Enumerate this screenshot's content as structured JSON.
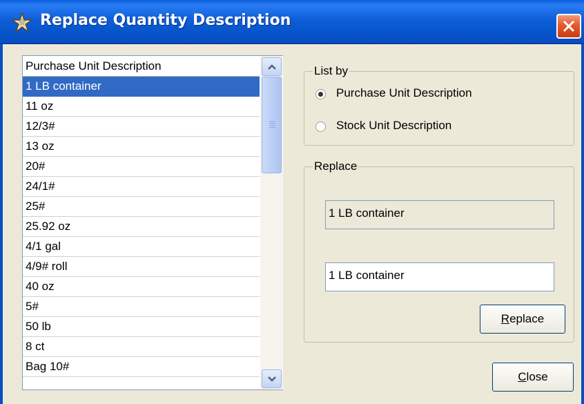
{
  "window": {
    "title": "Replace Quantity Description",
    "icon": "sparkle-app-icon",
    "close_icon": "close-x-icon"
  },
  "list": {
    "header": "Purchase Unit Description",
    "items": [
      "1 LB container",
      "11 oz",
      "12/3#",
      "13 oz",
      "20#",
      "24/1#",
      "25#",
      "25.92 oz",
      "4/1 gal",
      "4/9# roll",
      "40 oz",
      "5#",
      "50 lb",
      "8 ct",
      "Bag 10#"
    ],
    "selected_item": "1 LB container"
  },
  "list_by": {
    "label": "List by",
    "options": [
      "Purchase Unit Description",
      "Stock Unit Description"
    ],
    "selected": "Purchase Unit Description"
  },
  "replace": {
    "label": "Replace",
    "current_value": "1 LB container",
    "new_value": "1 LB container",
    "button_label_mnemonic": "R",
    "button_label_rest": "eplace"
  },
  "close_button": {
    "label_mnemonic": "C",
    "label_rest": "lose"
  },
  "colors": {
    "titlebar": "#0553c9",
    "selection": "#316ac5",
    "dialog_bg": "#ece9d8"
  }
}
